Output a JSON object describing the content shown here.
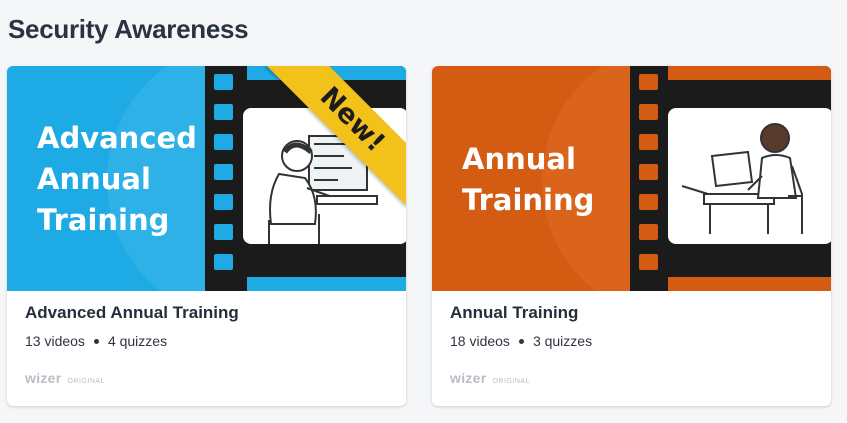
{
  "section": {
    "title": "Security Awareness"
  },
  "courses": [
    {
      "thumb_title": "Advanced Annual Training",
      "badge": "New!",
      "title": "Advanced Annual Training",
      "videos": "13 videos",
      "quizzes": "4 quizzes",
      "brand": "wizer",
      "brand_sub": "ORIGINAL",
      "color": "#1eaae4"
    },
    {
      "thumb_title": "Annual Training",
      "title": "Annual Training",
      "videos": "18 videos",
      "quizzes": "3 quizzes",
      "brand": "wizer",
      "brand_sub": "ORIGINAL",
      "color": "#d45b12"
    }
  ],
  "colors": {
    "blue": "#1eaae4",
    "orange": "#d45b12",
    "ribbon": "#f2c21b",
    "film": "#1b1b1b"
  }
}
